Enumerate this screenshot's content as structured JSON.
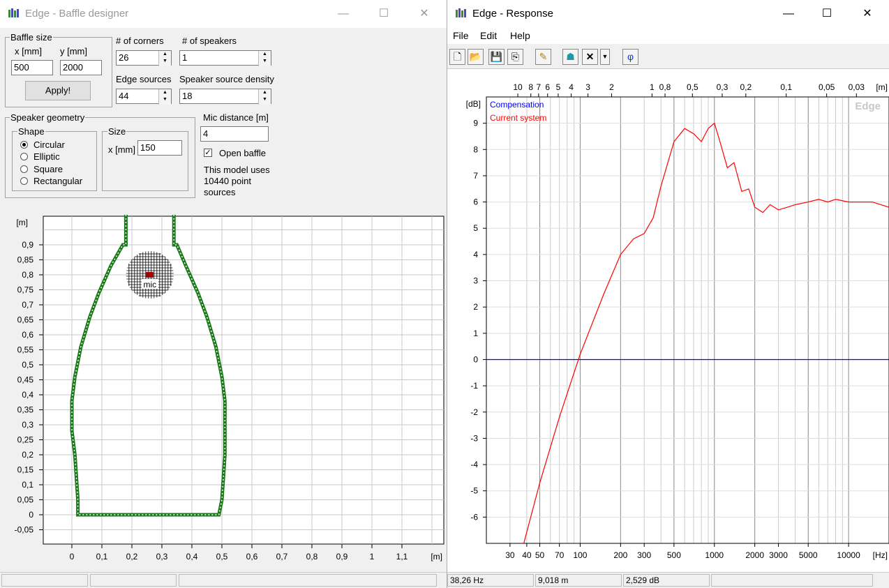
{
  "baffle_window": {
    "title": "Edge - Baffle designer",
    "window_controls": {
      "minimize": "—",
      "maximize": "☐",
      "close": "✕"
    },
    "baffle_size": {
      "group_label": "Baffle size",
      "x_label": "x [mm]",
      "y_label": "y [mm]",
      "x_value": "500",
      "y_value": "2000",
      "apply_label": "Apply!"
    },
    "corners": {
      "label": "# of corners",
      "value": "26"
    },
    "speakers": {
      "label": "# of speakers",
      "value": "1"
    },
    "edge_sources": {
      "label": "Edge sources",
      "value": "44"
    },
    "speaker_density": {
      "label": "Speaker source density",
      "value": "18"
    },
    "geometry": {
      "group_label": "Speaker geometry",
      "shape_label": "Shape",
      "shapes": [
        "Circular",
        "Elliptic",
        "Square",
        "Rectangular"
      ],
      "selected_shape": "Circular",
      "size_label": "Size",
      "size_field_label": "x [mm]",
      "size_value": "150"
    },
    "mic_distance": {
      "label": "Mic distance [m]",
      "value": "4"
    },
    "open_baffle": {
      "label": "Open baffle",
      "checked": true
    },
    "model_info": "This model uses 10440 point sources",
    "plot": {
      "unit_y": "[m]",
      "unit_x": "[m]",
      "mic_label": "mic",
      "y_ticks": [
        "0,9",
        "0,85",
        "0,8",
        "0,75",
        "0,7",
        "0,65",
        "0,6",
        "0,55",
        "0,5",
        "0,45",
        "0,4",
        "0,35",
        "0,3",
        "0,25",
        "0,2",
        "0,15",
        "0,1",
        "0,05",
        "0",
        "-0,05"
      ],
      "x_ticks": [
        "0",
        "0,1",
        "0,2",
        "0,3",
        "0,4",
        "0,5",
        "0,6",
        "0,7",
        "0,8",
        "0,9",
        "1",
        "1,1"
      ],
      "baffle_color": "#1a7a1a"
    },
    "status": [
      "",
      "",
      ""
    ]
  },
  "response_window": {
    "title": "Edge - Response",
    "window_controls": {
      "minimize": "—",
      "maximize": "☐",
      "close": "✕"
    },
    "menu": [
      "File",
      "Edit",
      "Help"
    ],
    "toolbar": [
      "new-icon",
      "open-icon",
      "save-icon",
      "copy-icon",
      "pencil-icon",
      "compensate-icon",
      "clear-icon",
      "dropdown-icon",
      "phase-icon"
    ],
    "phase_glyph": "φ",
    "status": [
      "38,26 Hz",
      "9,018 m",
      "2,529 dB",
      ""
    ]
  },
  "chart_data": {
    "type": "line",
    "ylabel": "[dB]",
    "xlabel": "[Hz]",
    "top_axis_unit": "[m]",
    "watermark": "Edge",
    "x_scale": "log",
    "xlim": [
      20,
      20000
    ],
    "ylim": [
      -7,
      10
    ],
    "grid": true,
    "legend_position": "top-left",
    "x_tick_labels": [
      "30",
      "40",
      "50",
      "70",
      "100",
      "200",
      "300",
      "500",
      "1000",
      "2000",
      "3000",
      "5000",
      "10000"
    ],
    "y_tick_labels": [
      "9",
      "8",
      "7",
      "6",
      "5",
      "4",
      "3",
      "2",
      "1",
      "0",
      "-1",
      "-2",
      "-3",
      "-4",
      "-5",
      "-6"
    ],
    "top_tick_labels": [
      "10",
      "8",
      "7",
      "6",
      "5",
      "4",
      "3",
      "2",
      "1",
      "0,8",
      "0,5",
      "0,3",
      "0,2",
      "0,1",
      "0,05",
      "0,03"
    ],
    "series": [
      {
        "name": "Compensation",
        "color": "#0000ff",
        "x": [
          20,
          20000
        ],
        "y": [
          0,
          0
        ]
      },
      {
        "name": "Current system",
        "color": "#ff0000",
        "x": [
          38,
          50,
          70,
          100,
          150,
          200,
          250,
          300,
          350,
          400,
          500,
          600,
          700,
          800,
          900,
          1000,
          1100,
          1250,
          1400,
          1600,
          1800,
          2000,
          2300,
          2600,
          3000,
          3500,
          4000,
          5000,
          6000,
          7000,
          8000,
          10000,
          12000,
          15000,
          20000
        ],
        "y": [
          -7,
          -4.7,
          -2.2,
          0.2,
          2.5,
          4.0,
          4.6,
          4.8,
          5.4,
          6.6,
          8.3,
          8.8,
          8.6,
          8.3,
          8.8,
          9.0,
          8.3,
          7.3,
          7.5,
          6.4,
          6.5,
          5.8,
          5.6,
          5.9,
          5.7,
          5.8,
          5.9,
          6.0,
          6.1,
          6.0,
          6.1,
          6.0,
          6.0,
          6.0,
          5.8
        ]
      }
    ]
  }
}
